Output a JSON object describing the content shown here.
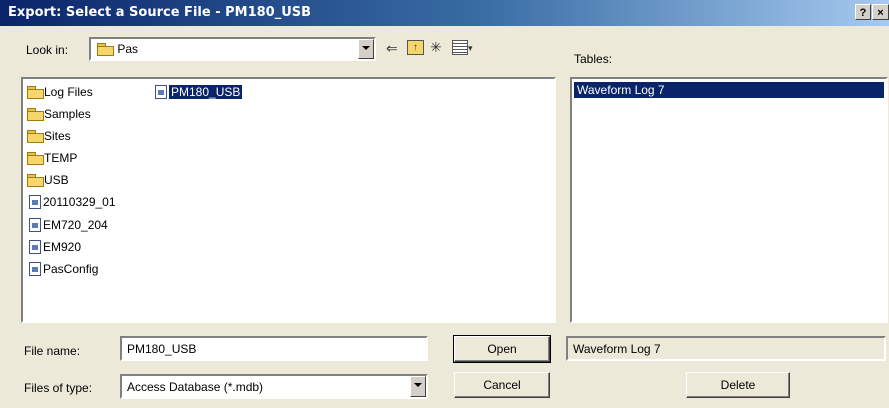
{
  "window": {
    "title": "Export: Select a Source File - PM180_USB",
    "help_button": "?",
    "close_button": "×"
  },
  "look_in": {
    "label": "Look in:",
    "value": "Pas"
  },
  "toolbar": {
    "back_icon": "back-arrow-icon",
    "up_icon": "up-folder-icon",
    "new_folder_icon": "new-folder-icon",
    "view_menu_icon": "view-menu-icon"
  },
  "files": {
    "folders": [
      "Log Files",
      "Samples",
      "Sites",
      "TEMP",
      "USB"
    ],
    "databases": [
      "20110329_01",
      "EM720_204",
      "EM920",
      "PasConfig"
    ],
    "selected": "PM180_USB"
  },
  "tables": {
    "label": "Tables:",
    "items": [
      "Waveform Log 7"
    ],
    "selected_value": "Waveform Log 7"
  },
  "file_name": {
    "label": "File name:",
    "value": "PM180_USB"
  },
  "file_type": {
    "label": "Files of type:",
    "value": "Access Database (*.mdb)"
  },
  "buttons": {
    "open": "Open",
    "cancel": "Cancel",
    "delete": "Delete"
  },
  "colors": {
    "title_start": "#0a246a",
    "title_end": "#a6caf0",
    "selection": "#0a246a",
    "dialog_bg": "#ece9d8"
  }
}
